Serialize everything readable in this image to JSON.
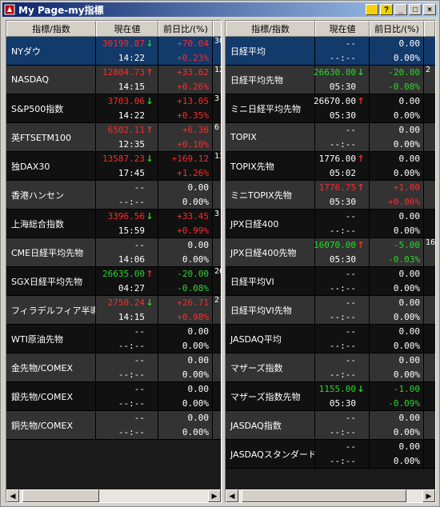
{
  "window": {
    "title": "My Page-my指標"
  },
  "titlebar_buttons": {
    "pin": "⚡",
    "help": "?",
    "minimize": "_",
    "maximize": "□",
    "close": "×"
  },
  "headers": {
    "name": "指標/指数",
    "price": "現在値",
    "change": "前日比/(%)"
  },
  "left_rows": [
    {
      "name": "NYダウ",
      "price": "30199.87",
      "price_color": "red",
      "arrow": "↓",
      "arrow_color": "green",
      "time": "14:22",
      "chg": "+70.04",
      "pct": "+0.23%",
      "chg_color": "red",
      "extra": "30",
      "selected": true
    },
    {
      "name": "NASDAQ",
      "price": "12804.73",
      "price_color": "red",
      "arrow": "↑",
      "arrow_color": "red",
      "time": "14:15",
      "chg": "+33.62",
      "pct": "+0.26%",
      "chg_color": "red",
      "extra": "12"
    },
    {
      "name": "S&P500指数",
      "price": "3703.06",
      "price_color": "red",
      "arrow": "↓",
      "arrow_color": "green",
      "time": "14:22",
      "chg": "+13.05",
      "pct": "+0.35%",
      "chg_color": "red",
      "extra": "3"
    },
    {
      "name": "英FTSETM100",
      "price": "6502.11",
      "price_color": "red",
      "arrow": "↑",
      "arrow_color": "red",
      "time": "12:35",
      "chg": "+6.36",
      "pct": "+0.10%",
      "chg_color": "red",
      "extra": "6"
    },
    {
      "name": "独DAX30",
      "price": "13587.23",
      "price_color": "red",
      "arrow": "↓",
      "arrow_color": "green",
      "time": "17:45",
      "chg": "+169.12",
      "pct": "+1.26%",
      "chg_color": "red",
      "extra": "13"
    },
    {
      "name": "香港ハンセン",
      "price": "--",
      "price_color": "white",
      "arrow": "",
      "arrow_color": "white",
      "time": "--:--",
      "chg": "0.00",
      "pct": "0.00%",
      "chg_color": "white",
      "extra": ""
    },
    {
      "name": "上海総合指数",
      "price": "3396.56",
      "price_color": "red",
      "arrow": "↓",
      "arrow_color": "green",
      "time": "15:59",
      "chg": "+33.45",
      "pct": "+0.99%",
      "chg_color": "red",
      "extra": "3"
    },
    {
      "name": "CME日経平均先物",
      "price": "--",
      "price_color": "white",
      "arrow": "",
      "arrow_color": "white",
      "time": "14:06",
      "chg": "0.00",
      "pct": "0.00%",
      "chg_color": "white",
      "extra": ""
    },
    {
      "name": "SGX日経平均先物",
      "price": "26635.00",
      "price_color": "green",
      "arrow": "↑",
      "arrow_color": "red",
      "time": "04:27",
      "chg": "-20.00",
      "pct": "-0.08%",
      "chg_color": "green",
      "extra": "26"
    },
    {
      "name": "フィラデルフィア半導",
      "price": "2750.24",
      "price_color": "red",
      "arrow": "↓",
      "arrow_color": "green",
      "time": "14:15",
      "chg": "+26.71",
      "pct": "+0.98%",
      "chg_color": "red",
      "extra": "2"
    },
    {
      "name": "WTI原油先物",
      "price": "--",
      "price_color": "white",
      "arrow": "",
      "arrow_color": "white",
      "time": "--:--",
      "chg": "0.00",
      "pct": "0.00%",
      "chg_color": "white",
      "extra": ""
    },
    {
      "name": "金先物/COMEX",
      "price": "--",
      "price_color": "white",
      "arrow": "",
      "arrow_color": "white",
      "time": "--:--",
      "chg": "0.00",
      "pct": "0.00%",
      "chg_color": "white",
      "extra": ""
    },
    {
      "name": "銀先物/COMEX",
      "price": "--",
      "price_color": "white",
      "arrow": "",
      "arrow_color": "white",
      "time": "--:--",
      "chg": "0.00",
      "pct": "0.00%",
      "chg_color": "white",
      "extra": ""
    },
    {
      "name": "銅先物/COMEX",
      "price": "--",
      "price_color": "white",
      "arrow": "",
      "arrow_color": "white",
      "time": "--:--",
      "chg": "0.00",
      "pct": "0.00%",
      "chg_color": "white",
      "extra": ""
    }
  ],
  "right_rows": [
    {
      "name": "日経平均",
      "price": "--",
      "price_color": "white",
      "arrow": "",
      "arrow_color": "white",
      "time": "--:--",
      "chg": "0.00",
      "pct": "0.00%",
      "chg_color": "white",
      "extra": "",
      "selected": true
    },
    {
      "name": "日経平均先物",
      "price": "26630.00",
      "price_color": "green",
      "arrow": "↓",
      "arrow_color": "green",
      "time": "05:30",
      "chg": "-20.00",
      "pct": "-0.08%",
      "chg_color": "green",
      "extra": "2"
    },
    {
      "name": "ミニ日経平均先物",
      "price": "26670.00",
      "price_color": "white",
      "arrow": "↑",
      "arrow_color": "red",
      "time": "05:30",
      "chg": "0.00",
      "pct": "0.00%",
      "chg_color": "white",
      "extra": ""
    },
    {
      "name": "TOPIX",
      "price": "--",
      "price_color": "white",
      "arrow": "",
      "arrow_color": "white",
      "time": "--:--",
      "chg": "0.00",
      "pct": "0.00%",
      "chg_color": "white",
      "extra": ""
    },
    {
      "name": "TOPIX先物",
      "price": "1776.00",
      "price_color": "white",
      "arrow": "↑",
      "arrow_color": "red",
      "time": "05:02",
      "chg": "0.00",
      "pct": "0.00%",
      "chg_color": "white",
      "extra": ""
    },
    {
      "name": "ミニTOPIX先物",
      "price": "1776.75",
      "price_color": "red",
      "arrow": "↑",
      "arrow_color": "red",
      "time": "05:30",
      "chg": "+1.00",
      "pct": "+0.06%",
      "chg_color": "red",
      "extra": ""
    },
    {
      "name": "JPX日経400",
      "price": "--",
      "price_color": "white",
      "arrow": "",
      "arrow_color": "white",
      "time": "--:--",
      "chg": "0.00",
      "pct": "0.00%",
      "chg_color": "white",
      "extra": ""
    },
    {
      "name": "JPX日経400先物",
      "price": "16070.00",
      "price_color": "green",
      "arrow": "↑",
      "arrow_color": "red",
      "time": "05:30",
      "chg": "-5.00",
      "pct": "-0.03%",
      "chg_color": "green",
      "extra": "16"
    },
    {
      "name": "日経平均VI",
      "price": "--",
      "price_color": "white",
      "arrow": "",
      "arrow_color": "white",
      "time": "--:--",
      "chg": "0.00",
      "pct": "0.00%",
      "chg_color": "white",
      "extra": ""
    },
    {
      "name": "日経平均VI先物",
      "price": "--",
      "price_color": "white",
      "arrow": "",
      "arrow_color": "white",
      "time": "--:--",
      "chg": "0.00",
      "pct": "0.00%",
      "chg_color": "white",
      "extra": ""
    },
    {
      "name": "JASDAQ平均",
      "price": "--",
      "price_color": "white",
      "arrow": "",
      "arrow_color": "white",
      "time": "--:--",
      "chg": "0.00",
      "pct": "0.00%",
      "chg_color": "white",
      "extra": ""
    },
    {
      "name": "マザーズ指数",
      "price": "--",
      "price_color": "white",
      "arrow": "",
      "arrow_color": "white",
      "time": "--:--",
      "chg": "0.00",
      "pct": "0.00%",
      "chg_color": "white",
      "extra": ""
    },
    {
      "name": "マザーズ指数先物",
      "price": "1155.00",
      "price_color": "green",
      "arrow": "↓",
      "arrow_color": "green",
      "time": "05:30",
      "chg": "-1.00",
      "pct": "-0.09%",
      "chg_color": "green",
      "extra": ""
    },
    {
      "name": "JASDAQ指数",
      "price": "--",
      "price_color": "white",
      "arrow": "",
      "arrow_color": "white",
      "time": "--:--",
      "chg": "0.00",
      "pct": "0.00%",
      "chg_color": "white",
      "extra": ""
    },
    {
      "name": "JASDAQスタンダード",
      "price": "--",
      "price_color": "white",
      "arrow": "",
      "arrow_color": "white",
      "time": "--:--",
      "chg": "0.00",
      "pct": "0.00%",
      "chg_color": "white",
      "extra": ""
    }
  ],
  "colors": {
    "red": "#ff2a2a",
    "green": "#2bd62b",
    "white": "#ffffff",
    "selected_row": "#123a6b"
  },
  "scrollbar": {
    "left_arrow": "◀",
    "right_arrow": "▶"
  }
}
